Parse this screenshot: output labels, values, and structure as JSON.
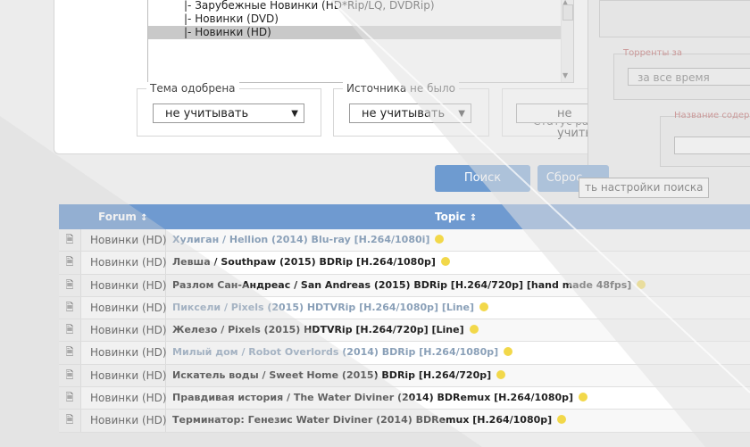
{
  "category_list": {
    "items": [
      {
        "label": "|- Зарубежные Новинки (HD*Rip/LQ, DVDRip)",
        "selected": false
      },
      {
        "label": "|- Новинки (DVD)",
        "selected": false
      },
      {
        "label": "|- Новинки (HD)",
        "selected": true
      }
    ]
  },
  "filters": {
    "approved": {
      "legend": "Тема одобрена",
      "value": "не учитывать"
    },
    "no_source": {
      "legend": "Источника не было",
      "value": "не учитывать"
    },
    "status": {
      "legend": "Статус раздачи",
      "value": "не учитывать"
    }
  },
  "right_panel": {
    "torrents_legend": "Торренты за",
    "torrents_value": "за все время",
    "name_legend": "Название содержит"
  },
  "buttons": {
    "search": "Поиск",
    "reset": "Сброс"
  },
  "tooltip": "ть настройки поиска",
  "table": {
    "headers": {
      "forum": "Forum",
      "topic": "Topic",
      "sort_icon": "↕"
    },
    "rows": [
      {
        "forum": "Новинки (HD)",
        "topic": "Хулиган / Hellion (2014) Blu-ray [H.264/1080i]"
      },
      {
        "forum": "Новинки (HD)",
        "topic": "Левша / Southpaw (2015) BDRip [H.264/1080p]"
      },
      {
        "forum": "Новинки (HD)",
        "topic": "Разлом Сан-Андреас / San Andreas (2015) BDRip [H.264/720p] [hand made 48fps]"
      },
      {
        "forum": "Новинки (HD)",
        "topic": "Пиксели / Pixels (2015) HDTVRip [H.264/1080p] [Line]"
      },
      {
        "forum": "Новинки (HD)",
        "topic": "Железо / Pixels (2015) HDTVRip [H.264/720p] [Line]"
      },
      {
        "forum": "Новинки (HD)",
        "topic": "Милый дом / Robot Overlords (2014) BDRip [H.264/1080p]"
      },
      {
        "forum": "Новинки (HD)",
        "topic": "Искатель воды / Sweet Home (2015) BDRip [H.264/720p]"
      },
      {
        "forum": "Новинки (HD)",
        "topic": "Правдивая история / The Water Diviner (2014) BDRemux [H.264/1080p]"
      },
      {
        "forum": "Новинки (HD)",
        "topic": "Терминатор: Генезис Water Diviner (2014) BDRemux [H.264/1080p]"
      }
    ]
  }
}
